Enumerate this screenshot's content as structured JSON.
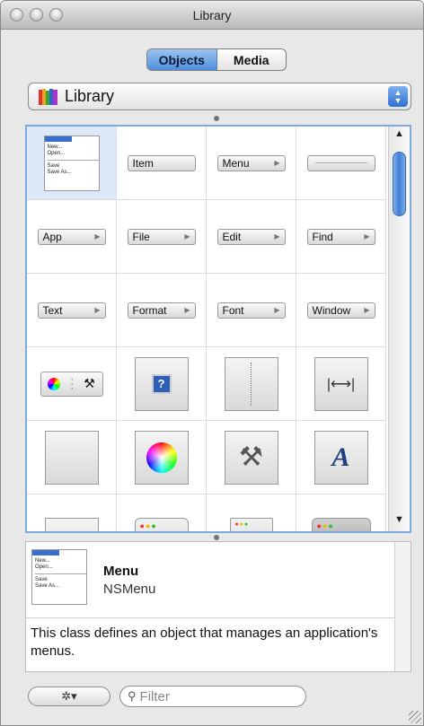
{
  "window": {
    "title": "Library"
  },
  "tabs": [
    {
      "label": "Objects",
      "selected": true
    },
    {
      "label": "Media",
      "selected": false
    }
  ],
  "library_popup": {
    "label": "Library"
  },
  "menu_thumb": {
    "items": [
      "New...",
      "Open..."
    ],
    "items2": [
      "Save",
      "Save As..."
    ]
  },
  "grid_row1": [
    {
      "label": "Item"
    },
    {
      "label": "Menu"
    }
  ],
  "grid_row2": [
    {
      "label": "App"
    },
    {
      "label": "File"
    },
    {
      "label": "Edit"
    },
    {
      "label": "Find"
    }
  ],
  "grid_row3": [
    {
      "label": "Text"
    },
    {
      "label": "Format"
    },
    {
      "label": "Font"
    },
    {
      "label": "Window"
    }
  ],
  "info": {
    "name": "Menu",
    "class_name": "NSMenu",
    "description": "This class defines an object that manages an application's menus."
  },
  "toolbar": {
    "gear_glyph": "✲▾",
    "filter_placeholder": "Filter"
  },
  "colors": {
    "accent": "#4f8fdd",
    "selection": "#dde9f8"
  }
}
